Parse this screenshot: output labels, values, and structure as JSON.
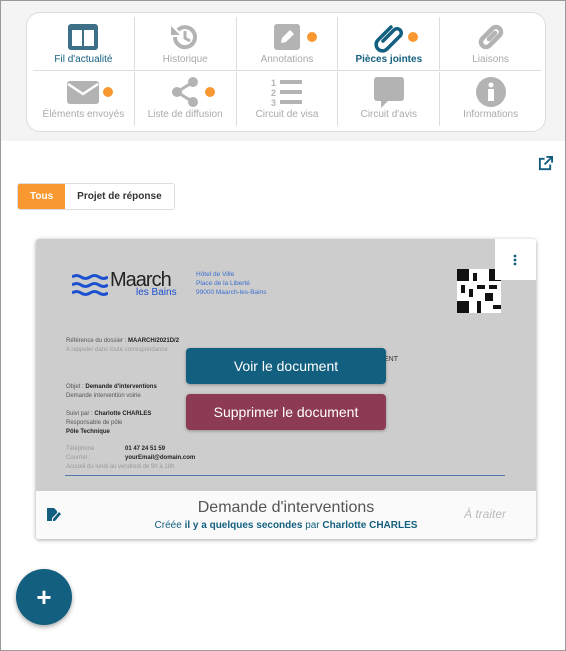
{
  "colors": {
    "primary": "#135f7f",
    "accent": "#f99830",
    "danger": "#8c3b52",
    "inactive": "#b3b3b3"
  },
  "nav": {
    "row1": [
      {
        "label": "Fil d'actualité",
        "icon": "columns-icon",
        "state": "active",
        "dot": false
      },
      {
        "label": "Historique",
        "icon": "history-icon",
        "state": "",
        "dot": false
      },
      {
        "label": "Annotations",
        "icon": "pencil-square-icon",
        "state": "",
        "dot": true
      },
      {
        "label": "Pièces jointes",
        "icon": "paperclip-icon",
        "state": "selected",
        "dot": true
      },
      {
        "label": "Liaisons",
        "icon": "link-icon",
        "state": "",
        "dot": false
      }
    ],
    "row2": [
      {
        "label": "Éléments envoyés",
        "icon": "envelope-icon",
        "state": "",
        "dot": true
      },
      {
        "label": "Liste de diffusion",
        "icon": "share-icon",
        "state": "",
        "dot": true
      },
      {
        "label": "Circuit de visa",
        "icon": "numbered-list-icon",
        "state": "",
        "dot": false
      },
      {
        "label": "Circuit d'avis",
        "icon": "comment-icon",
        "state": "",
        "dot": false
      },
      {
        "label": "Informations",
        "icon": "info-circle-icon",
        "state": "",
        "dot": false
      }
    ]
  },
  "filters": {
    "all": "Tous",
    "reply": "Projet de réponse"
  },
  "card": {
    "doc": {
      "logo_main": "Maarch",
      "logo_sub": "les Bains",
      "addr1": "Hôtel de Ville",
      "addr2": "Place de la Liberté",
      "addr3": "99000 Maarch-les-Bains",
      "ref_label": "Référence du dossier :",
      "ref_value": "MAARCH/2021D/2",
      "ref_note": "A rappeler dans toute correspondance",
      "obj_label": "Objet :",
      "obj_value": "Demande d'interventions",
      "obj_line2": "Demande intervention voirie",
      "suivi_label": "Suivi par :",
      "suivi_value": "Charlotte CHARLES",
      "suivi_role": "Responsable de pôle",
      "suivi_dept": "Pôle Technique",
      "tel_label": "Téléphone :",
      "tel_value": "01 47 24 51 59",
      "mail_label": "Courriel :",
      "mail_value": "yourEmail@domain.com",
      "hours": "Accueil du lundi au vendredi de 9h à 18h",
      "partial": "ENT"
    },
    "view_button": "Voir le document",
    "delete_button": "Supprimer le document",
    "title": "Demande d'interventions",
    "created_prefix": "Créée",
    "created_when": "il y a quelques secondes",
    "created_by_prefix": "par",
    "created_by": "Charlotte CHARLES",
    "status": "À traiter"
  },
  "fab": "+"
}
